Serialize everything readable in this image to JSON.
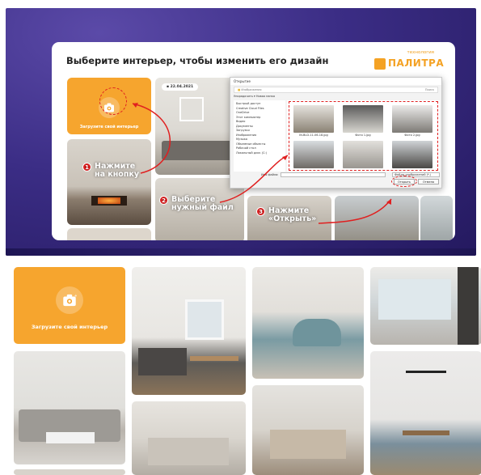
{
  "banner": {
    "title": "Выберите интерьер, чтобы изменить его дизайн",
    "logo_small": "технология",
    "logo_word": "ПАЛИТРА",
    "upload_label": "Загрузите свой интерьер",
    "date": "22.04.2021",
    "steps": [
      {
        "num": "1",
        "line1": "Нажмите",
        "line2": "на кнопку"
      },
      {
        "num": "2",
        "line1": "Выберите",
        "line2": "нужный файл"
      },
      {
        "num": "3",
        "line1": "Нажмите",
        "line2": "«Открыть»"
      }
    ]
  },
  "dialog": {
    "title": "Открытие",
    "address": "Изображения",
    "search": "Поиск",
    "toolbar": "Упорядочить ▾    Новая папка",
    "sidebar": [
      "Быстрый доступ",
      "Creative Cloud Files",
      "OneDrive",
      "Этот компьютер",
      "Видео",
      "Документы",
      "Загрузки",
      "Изображения",
      "Музыка",
      "Объемные объекты",
      "Рабочий стол",
      "Локальный диск (C:)"
    ],
    "files": [
      "IN-BLD-11-06-18.jpg",
      "Фото 1.jpg",
      "Фото 2.jpg",
      "Фото 3.jpg",
      "Фото 4.jpg",
      "Фото 5.jpg"
    ],
    "filename_label": "Имя файла:",
    "filter": "Файлы изображений (*.j",
    "open_button": "Открыть",
    "cancel_button": "Отмена"
  },
  "grid": {
    "upload_label": "Загрузите свой интерьер"
  },
  "colors": {
    "accent": "#f6a52e",
    "banner_bg": "#3b2d85",
    "marker_red": "#e02020"
  }
}
